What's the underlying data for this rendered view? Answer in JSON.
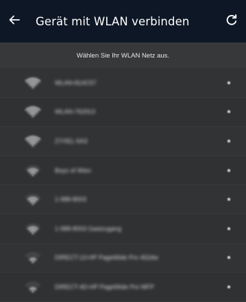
{
  "header": {
    "title": "Gerät mit WLAN verbinden",
    "back_icon": "arrow-left-icon",
    "refresh_icon": "refresh-icon",
    "background_color": "#0e1726"
  },
  "instruction": "Wählen Sie Ihr WLAN Netz aus.",
  "networks": [
    {
      "ssid": "WLAN-814C57",
      "signal": 4,
      "icon": "wifi-icon",
      "secured_icon": "lock-icon"
    },
    {
      "ssid": "WLAN-762913",
      "signal": 4,
      "icon": "wifi-icon",
      "secured_icon": "lock-icon"
    },
    {
      "ssid": "ZYXEL-5A3",
      "signal": 4,
      "icon": "wifi-icon",
      "secured_icon": "lock-icon"
    },
    {
      "ssid": "Boys of Wien",
      "signal": 3,
      "icon": "wifi-icon",
      "secured_icon": "lock-icon"
    },
    {
      "ssid": "1-988-8003",
      "signal": 3,
      "icon": "wifi-icon",
      "secured_icon": "lock-icon"
    },
    {
      "ssid": "1-988-8003 Gastzugang",
      "signal": 3,
      "icon": "wifi-icon",
      "secured_icon": "lock-icon"
    },
    {
      "ssid": "DIRECT-13-HP PageWide Pro 452dw",
      "signal": 2,
      "icon": "wifi-icon",
      "secured_icon": "lock-icon"
    },
    {
      "ssid": "DIRECT-4D-HP PageWide Pro MFP",
      "signal": 2,
      "icon": "wifi-icon",
      "secured_icon": "lock-icon"
    }
  ]
}
